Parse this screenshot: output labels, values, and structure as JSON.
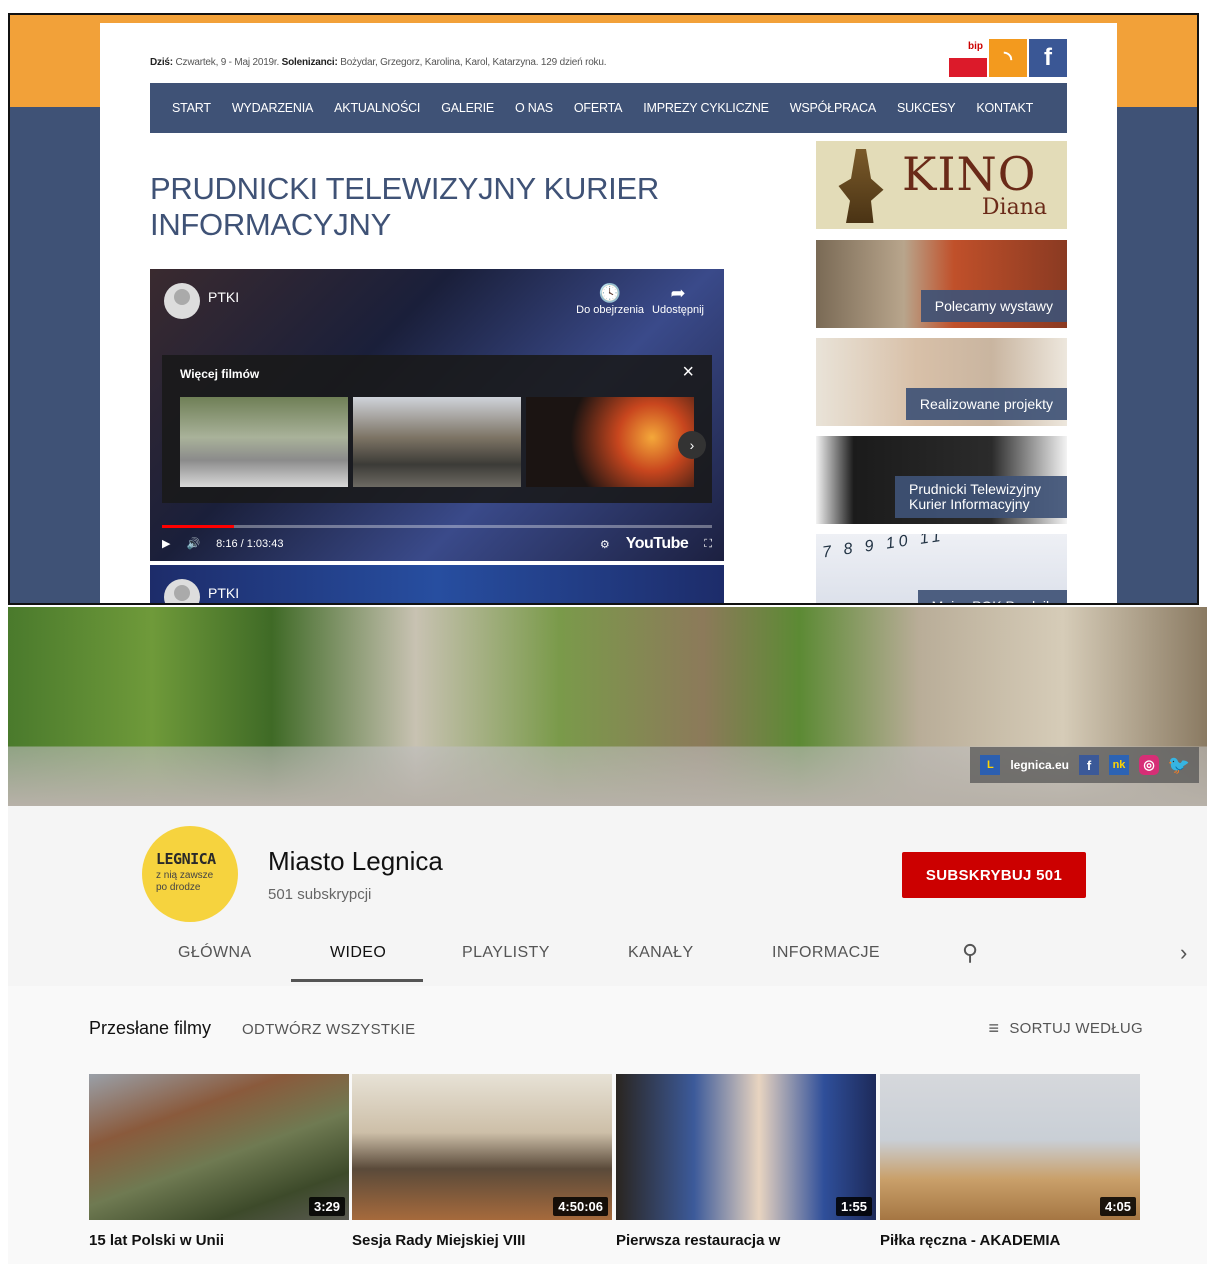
{
  "portal": {
    "date_label": "Dziś:",
    "date_text": "Czwartek, 9 - Maj 2019r.",
    "name_label": "Solenizanci:",
    "name_text": "Bożydar, Grzegorz, Karolina, Karol, Katarzyna. 129 dzień roku.",
    "bip_label": "bip",
    "rss_icon": "rss-icon",
    "fb_icon": "facebook-icon",
    "nav": [
      "START",
      "WYDARZENIA",
      "AKTUALNOŚCI",
      "GALERIE",
      "O NAS",
      "OFERTA",
      "IMPREZY CYKLICZNE",
      "WSPÓŁPRACA",
      "SUKCESY",
      "KONTAKT"
    ],
    "page_title": "PRUDNICKI TELEWIZYJNY KURIER INFORMACYJNY",
    "player": {
      "channel": "PTKI",
      "watch_later": "Do obejrzenia",
      "share": "Udostępnij",
      "more_videos": "Więcej filmów",
      "time": "8:16 / 1:03:43",
      "progress_fraction": 0.13,
      "youtube_label": "YouTube"
    },
    "player2": {
      "channel": "PTKI"
    },
    "sidebar": {
      "kino_title": "KINO",
      "kino_sub": "Diana",
      "tiles": [
        "Polecamy wystawy",
        "Realizowane projekty",
        "Prudnicki Telewizyjny Kurier Informacyjny",
        "Maj w POK Prudnik"
      ]
    }
  },
  "youtube": {
    "banner_link": "legnica.eu",
    "banner_social": [
      "f",
      "nk"
    ],
    "logo_line1": "LEGNICA",
    "logo_line2": "z nią zawsze po drodze",
    "channel_name": "Miasto Legnica",
    "subscribers": "501 subskrypcji",
    "subscribe_button": "SUBSKRYBUJ  501",
    "tabs": [
      "GŁÓWNA",
      "WIDEO",
      "PLAYLISTY",
      "KANAŁY",
      "INFORMACJE"
    ],
    "active_tab": "WIDEO",
    "section_title": "Przesłane filmy",
    "play_all": "ODTWÓRZ WSZYSTKIE",
    "sort": "SORTUJ WEDŁUG",
    "videos": [
      {
        "title": "15 lat Polski w Unii",
        "duration": "3:29"
      },
      {
        "title": "Sesja Rady Miejskiej VIII",
        "duration": "4:50:06"
      },
      {
        "title": "Pierwsza restauracja w",
        "duration": "1:55"
      },
      {
        "title": "Piłka ręczna - AKADEMIA",
        "duration": "4:05"
      }
    ],
    "accent_color": "#cc0000"
  }
}
